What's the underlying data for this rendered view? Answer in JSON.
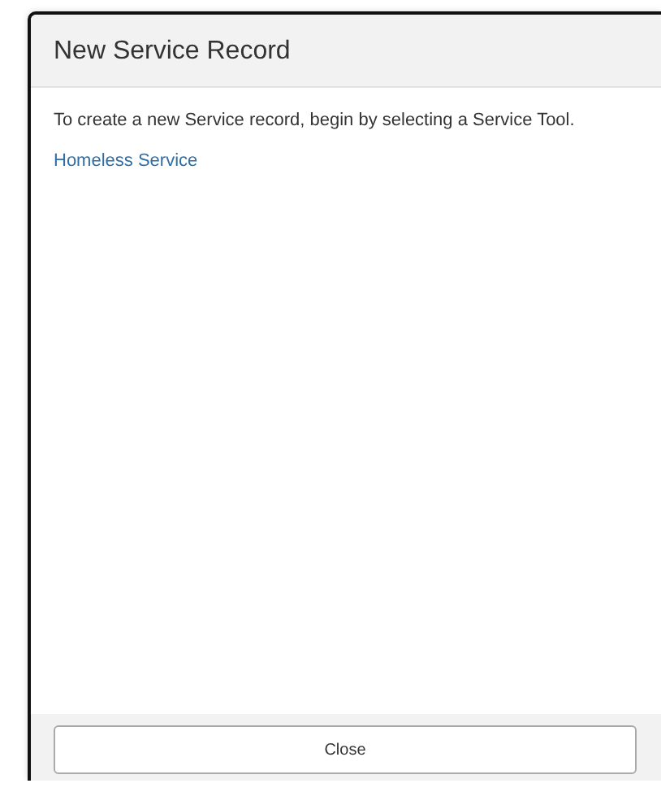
{
  "dialog": {
    "title": "New Service Record",
    "message": "To create a new Service record, begin by selecting a Service Tool.",
    "links": [
      "Homeless Service"
    ],
    "buttons": [
      "Close"
    ]
  }
}
